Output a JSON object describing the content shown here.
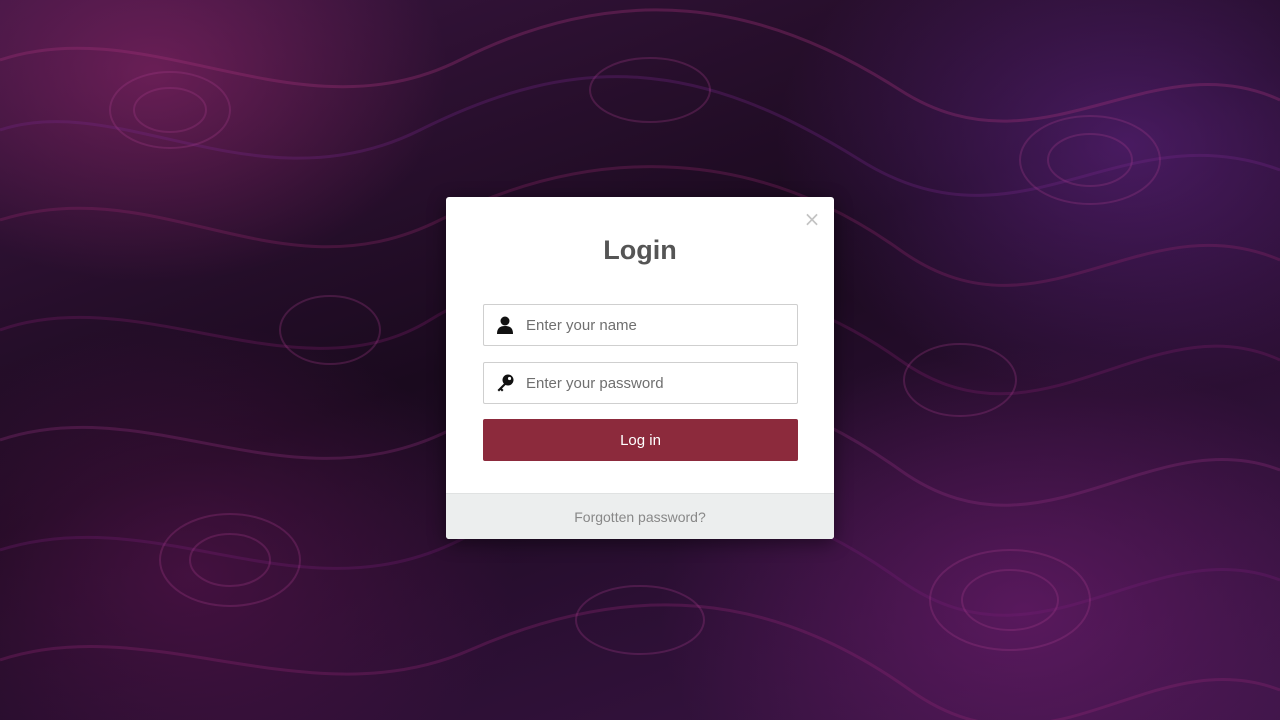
{
  "background": {
    "description_colors": [
      "#2a0f2e",
      "#6b1e6e",
      "#3b1546"
    ]
  },
  "modal": {
    "title": "Login",
    "close_label": "×",
    "name_field": {
      "placeholder": "Enter your name",
      "value": "",
      "icon": "user-icon"
    },
    "password_field": {
      "placeholder": "Enter your password",
      "value": "",
      "icon": "key-icon"
    },
    "login_button_label": "Log in",
    "forgot_link_label": "Forgotten password?"
  },
  "colors": {
    "accent": "#8c2a3c",
    "title_text": "#555555",
    "footer_bg": "#eceeee",
    "footer_text": "#888888"
  }
}
